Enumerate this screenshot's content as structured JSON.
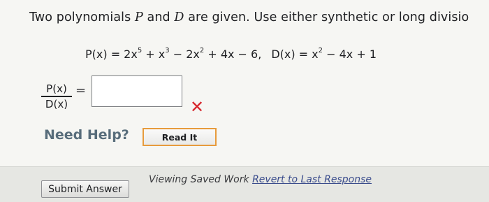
{
  "question": {
    "prompt_parts": [
      "Two polynomials ",
      "P",
      " and ",
      "D",
      " are given. Use either synthetic or long divisio"
    ],
    "equation": {
      "p_lhs": "P(x) = 2x",
      "p_exp1": "5",
      "p_mid1": " + x",
      "p_exp2": "3",
      "p_mid2": " − 2x",
      "p_exp3": "2",
      "p_tail": " + 4x − 6,",
      "d_lhs": "D(x) = x",
      "d_exp": "2",
      "d_tail": " − 4x + 1"
    },
    "fraction_numerator": "P(x)",
    "fraction_denominator": "D(x)",
    "equals_sign": "=",
    "answer_value": "",
    "wrong_mark": "✕"
  },
  "help": {
    "label": "Need Help?",
    "read_button": "Read It"
  },
  "footer": {
    "submit_button": "Submit Answer",
    "saved_work_text": "Viewing Saved Work ",
    "revert_link": "Revert to Last Response"
  },
  "colors": {
    "background": "#e6e7e3",
    "panel": "#f6f6f3",
    "help_text": "#586d7b",
    "button_border": "#e79b3c",
    "error_mark": "#d7262c",
    "link": "#3a4c8c"
  },
  "icons": {
    "wrong_mark": "x-mark-icon"
  }
}
